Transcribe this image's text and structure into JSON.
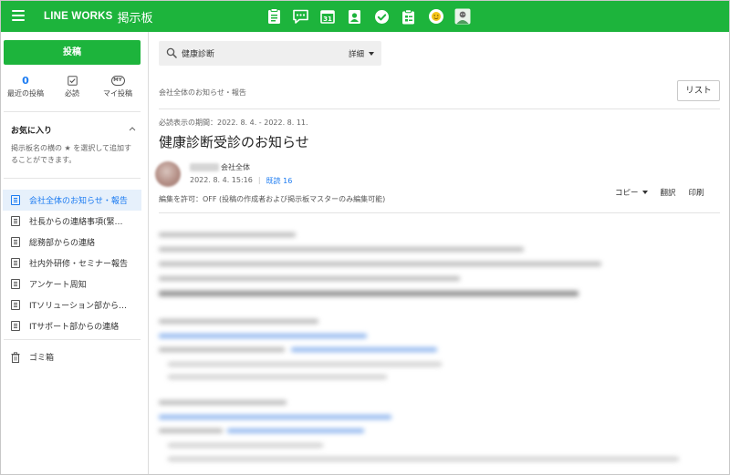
{
  "topbar": {
    "brand": "LINE WORKS",
    "app_name": "掲示板",
    "app_icons": [
      "board-icon",
      "chat-icon",
      "calendar-icon",
      "address-book-icon",
      "task-check-icon",
      "survey-icon",
      "emoji-icon",
      "avatar-icon"
    ]
  },
  "sidebar": {
    "post_button": "投稿",
    "quick": {
      "recent_count": "0",
      "recent_label": "最近の投稿",
      "must_read_label": "必読",
      "my_posts_badge": "MY",
      "my_posts_label": "マイ投稿"
    },
    "favorites": {
      "title": "お気に入り",
      "help": "掲示板名の横の ★ を選択して追加することができます。"
    },
    "boards": [
      {
        "label": "会社全体のお知らせ・報告",
        "active": true
      },
      {
        "label": "社長からの連絡事項(緊…",
        "active": false
      },
      {
        "label": "総務部からの連絡",
        "active": false
      },
      {
        "label": "社内外研修・セミナー報告",
        "active": false
      },
      {
        "label": "アンケート周知",
        "active": false
      },
      {
        "label": "ITソリューション部から…",
        "active": false
      },
      {
        "label": "ITサポート部からの連絡",
        "active": false
      }
    ],
    "trash": "ゴミ箱"
  },
  "main": {
    "search": {
      "value": "健康診断",
      "detail": "詳細"
    },
    "breadcrumb": "会社全体のお知らせ・報告",
    "list_button": "リスト",
    "post": {
      "period": "必読表示の期間：2022. 8. 4. - 2022. 8. 11.",
      "title": "健康診断受診のお知らせ",
      "author_org": "会社全体",
      "datetime": "2022. 8. 4. 15:16",
      "read_count": "既読 16",
      "edit_permission": "編集を許可：OFF (投稿の作成者および掲示板マスターのみ編集可能)",
      "actions": {
        "copy": "コピー",
        "translate": "翻訳",
        "print": "印刷"
      }
    }
  },
  "colors": {
    "brand_green": "#1db43c",
    "accent_blue": "#1d7cf2",
    "active_bg": "#e6f0fb"
  }
}
